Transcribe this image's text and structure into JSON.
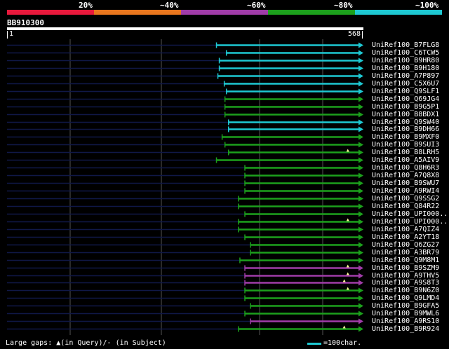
{
  "legend": {
    "labels": [
      "20%",
      "~40%",
      "~60%",
      "~80%",
      "~100%"
    ],
    "colors": [
      "#e8193c",
      "#e8761e",
      "#a03ca8",
      "#1ca01c",
      "#1ec8d2"
    ]
  },
  "query": {
    "name": "BB910300",
    "start": "1",
    "end": "568"
  },
  "hits": [
    {
      "id": "UniRef100_B7FLG8",
      "start": 0.59,
      "band": 4
    },
    {
      "id": "UniRef100_C6TCW5",
      "start": 0.618,
      "band": 4
    },
    {
      "id": "UniRef100_B9HR80",
      "start": 0.598,
      "band": 4
    },
    {
      "id": "UniRef100_B9H180",
      "start": 0.598,
      "band": 4
    },
    {
      "id": "UniRef100_A7P897",
      "start": 0.594,
      "band": 4
    },
    {
      "id": "UniRef100_C5X6U7",
      "start": 0.612,
      "band": 4
    },
    {
      "id": "UniRef100_Q9SLF1",
      "start": 0.618,
      "band": 4
    },
    {
      "id": "UniRef100_Q69JG4",
      "start": 0.614,
      "band": 3
    },
    {
      "id": "UniRef100_B9G5P1",
      "start": 0.614,
      "band": 3
    },
    {
      "id": "UniRef100_B8BDX1",
      "start": 0.614,
      "band": 3
    },
    {
      "id": "UniRef100_Q9SW40",
      "start": 0.624,
      "band": 4
    },
    {
      "id": "UniRef100_B9DH66",
      "start": 0.624,
      "band": 4
    },
    {
      "id": "UniRef100_B9MXF0",
      "start": 0.606,
      "band": 3
    },
    {
      "id": "UniRef100_B9SUI3",
      "start": 0.614,
      "band": 3
    },
    {
      "id": "UniRef100_B8LRH5",
      "start": 0.624,
      "band": 3,
      "gap_mark": 0.96
    },
    {
      "id": "UniRef100_A5AIV9",
      "start": 0.59,
      "band": 3
    },
    {
      "id": "UniRef100_Q8H6R3",
      "start": 0.67,
      "band": 3
    },
    {
      "id": "UniRef100_A7Q8X8",
      "start": 0.67,
      "band": 3
    },
    {
      "id": "UniRef100_B9SWU7",
      "start": 0.67,
      "band": 3
    },
    {
      "id": "UniRef100_A9RWI4",
      "start": 0.67,
      "band": 3
    },
    {
      "id": "UniRef100_Q9SSG2",
      "start": 0.652,
      "band": 3
    },
    {
      "id": "UniRef100_Q84R22",
      "start": 0.652,
      "band": 3
    },
    {
      "id": "UniRef100_UPI000..",
      "start": 0.67,
      "band": 3
    },
    {
      "id": "UniRef100_UPI000..",
      "start": 0.652,
      "band": 3,
      "gap_mark": 0.96
    },
    {
      "id": "UniRef100_A7QIZ4",
      "start": 0.652,
      "band": 3
    },
    {
      "id": "UniRef100_A2YT18",
      "start": 0.67,
      "band": 3
    },
    {
      "id": "UniRef100_Q6ZG27",
      "start": 0.686,
      "band": 3
    },
    {
      "id": "UniRef100_A3BR79",
      "start": 0.686,
      "band": 3
    },
    {
      "id": "UniRef100_Q9M8M1",
      "start": 0.656,
      "band": 3
    },
    {
      "id": "UniRef100_B9SZM9",
      "start": 0.67,
      "band": 2,
      "gap_mark": 0.96
    },
    {
      "id": "UniRef100_A9THV5",
      "start": 0.67,
      "band": 2,
      "gap_mark": 0.96
    },
    {
      "id": "UniRef100_A9S8T3",
      "start": 0.67,
      "band": 2,
      "gap_mark": 0.95
    },
    {
      "id": "UniRef100_B9N6Z0",
      "start": 0.67,
      "band": 3,
      "gap_mark": 0.96
    },
    {
      "id": "UniRef100_Q9LMD4",
      "start": 0.67,
      "band": 3
    },
    {
      "id": "UniRef100_B9GFA5",
      "start": 0.686,
      "band": 3
    },
    {
      "id": "UniRef100_B9MWL6",
      "start": 0.67,
      "band": 3
    },
    {
      "id": "UniRef100_A9RS10",
      "start": 0.686,
      "band": 2
    },
    {
      "id": "UniRef100_B9R924",
      "start": 0.652,
      "band": 3,
      "gap_mark": 0.95
    }
  ],
  "footer": {
    "large_gaps": "Large gaps:",
    "in_query": "(in Query)/",
    "dash": "-",
    "in_subject": " (in Subject)",
    "key": "=100char."
  }
}
